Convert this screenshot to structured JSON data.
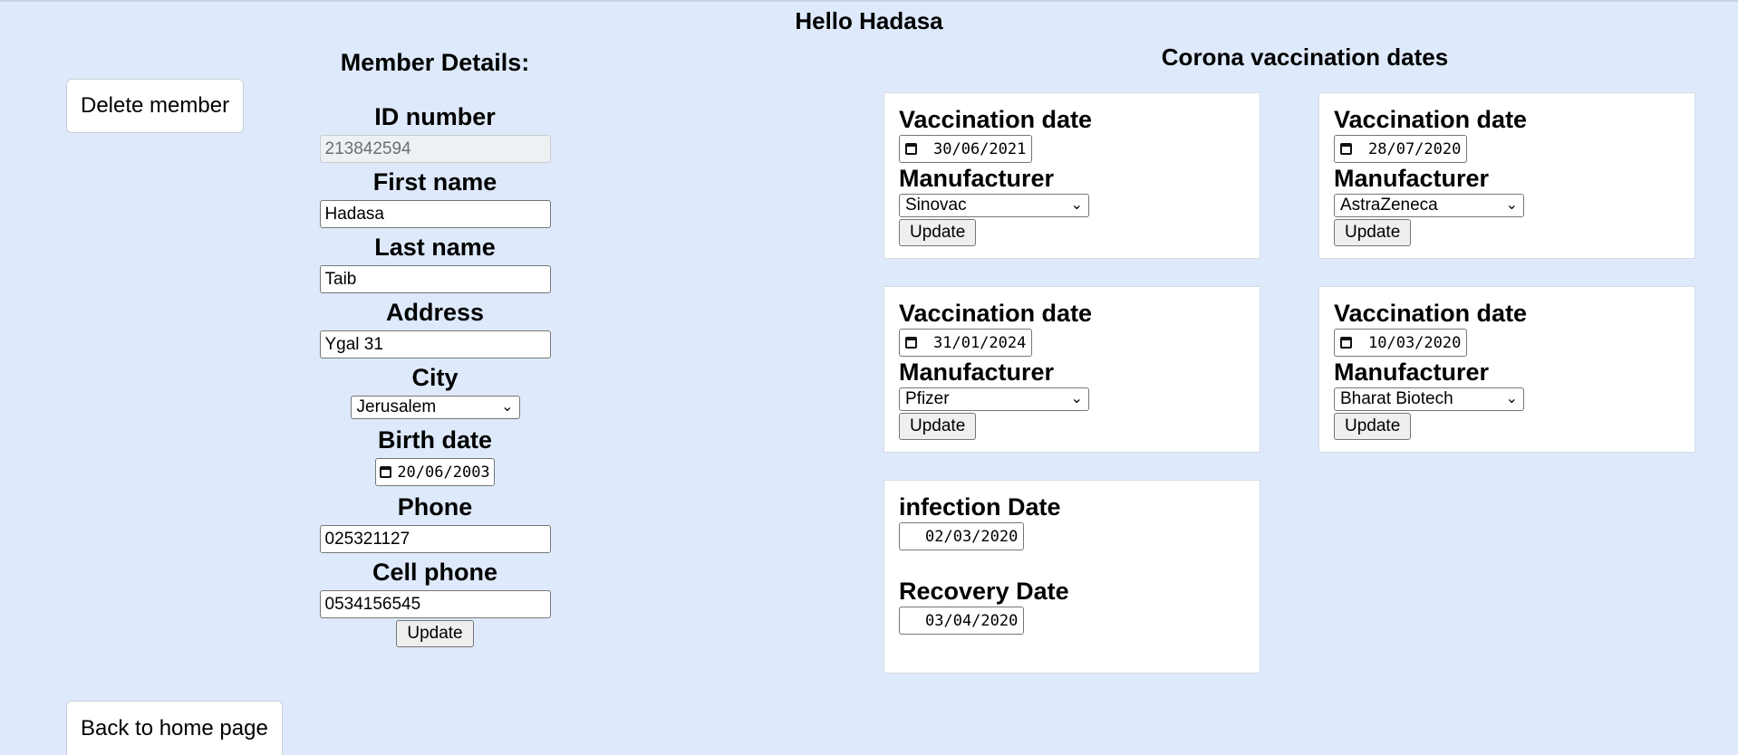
{
  "greeting": "Hello Hadasa",
  "actions": {
    "delete_label": "Delete member",
    "back_home_label": "Back to home page"
  },
  "member": {
    "title": "Member Details:",
    "id_label": "ID number",
    "id_value": "213842594",
    "first_name_label": "First name",
    "first_name_value": "Hadasa",
    "last_name_label": "Last name",
    "last_name_value": "Taib",
    "address_label": "Address",
    "address_value": "Ygal 31",
    "city_label": "City",
    "city_value": "Jerusalem",
    "birth_label": "Birth date",
    "birth_value": "20/06/2003",
    "phone_label": "Phone",
    "phone_value": "025321127",
    "cell_label": "Cell phone",
    "cell_value": "0534156545",
    "update_label": "Update"
  },
  "vaccinations": {
    "title": "Corona vaccination dates",
    "date_label": "Vaccination date",
    "manufacturer_label": "Manufacturer",
    "update_label": "Update",
    "items": [
      {
        "date": "30/06/2021",
        "manufacturer": "Sinovac"
      },
      {
        "date": "28/07/2020",
        "manufacturer": "AstraZeneca"
      },
      {
        "date": "31/01/2024",
        "manufacturer": "Pfizer"
      },
      {
        "date": "10/03/2020",
        "manufacturer": "Bharat Biotech"
      }
    ]
  },
  "infection": {
    "infection_label": "infection Date",
    "infection_value": "02/03/2020",
    "recovery_label": "Recovery Date",
    "recovery_value": "03/04/2020"
  }
}
